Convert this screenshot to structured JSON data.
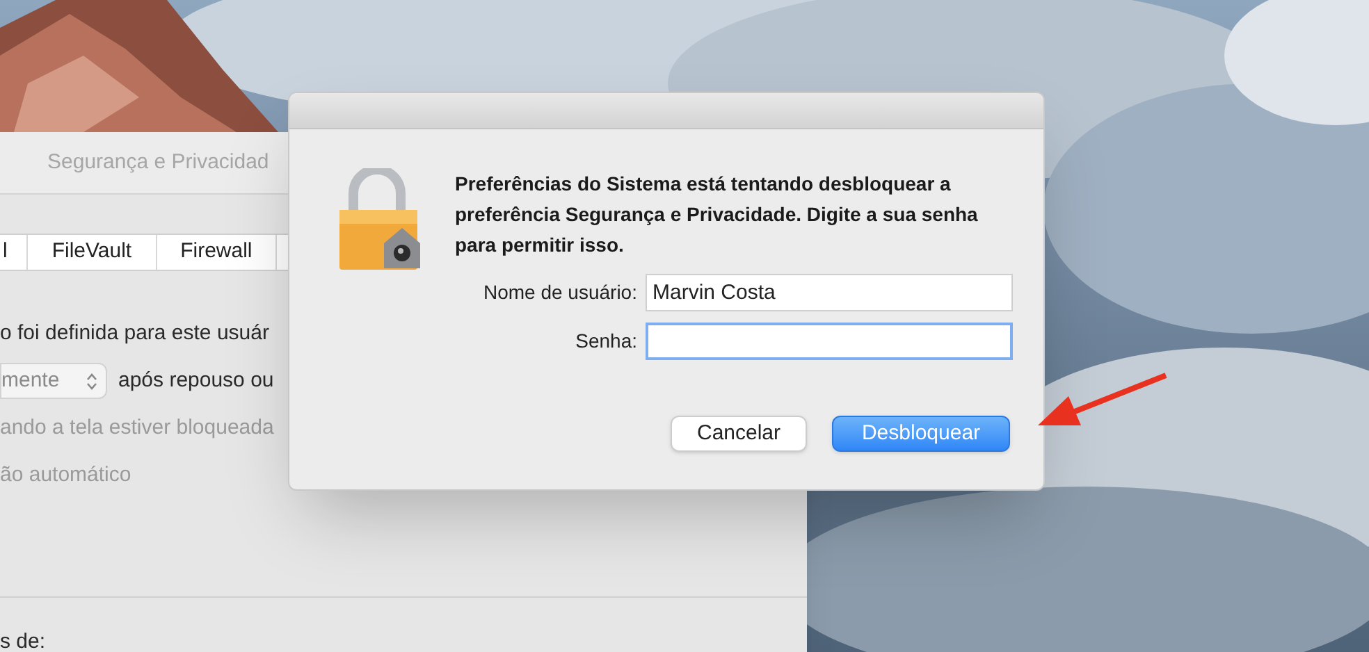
{
  "background_window": {
    "title": "Segurança e Privacidad",
    "tabs": [
      {
        "label": "l",
        "selected": false
      },
      {
        "label": "FileVault",
        "selected": false
      },
      {
        "label": "Firewall",
        "selected": false
      }
    ],
    "lines": [
      {
        "kind": "text",
        "text": "o foi definida para este usuár",
        "disabled": false
      },
      {
        "kind": "popup",
        "value": "mente",
        "text": "após repouso ou",
        "disabled": false
      },
      {
        "kind": "text",
        "text": "ando a tela estiver bloqueada",
        "disabled": true
      },
      {
        "kind": "text",
        "text": "ão automático",
        "disabled": true
      }
    ],
    "footer": "s de:"
  },
  "dialog": {
    "message": "Preferências do Sistema está tentando desbloquear a preferência Segurança e Privacidade. Digite a sua senha para permitir isso.",
    "fields": [
      {
        "label": "Nome de usuário:",
        "value": "Marvin Costa",
        "focused": false
      },
      {
        "label": "Senha:",
        "focused": true
      }
    ],
    "buttons": [
      {
        "label": "Cancelar",
        "default": false
      },
      {
        "label": "Desbloquear",
        "default": true
      }
    ]
  }
}
